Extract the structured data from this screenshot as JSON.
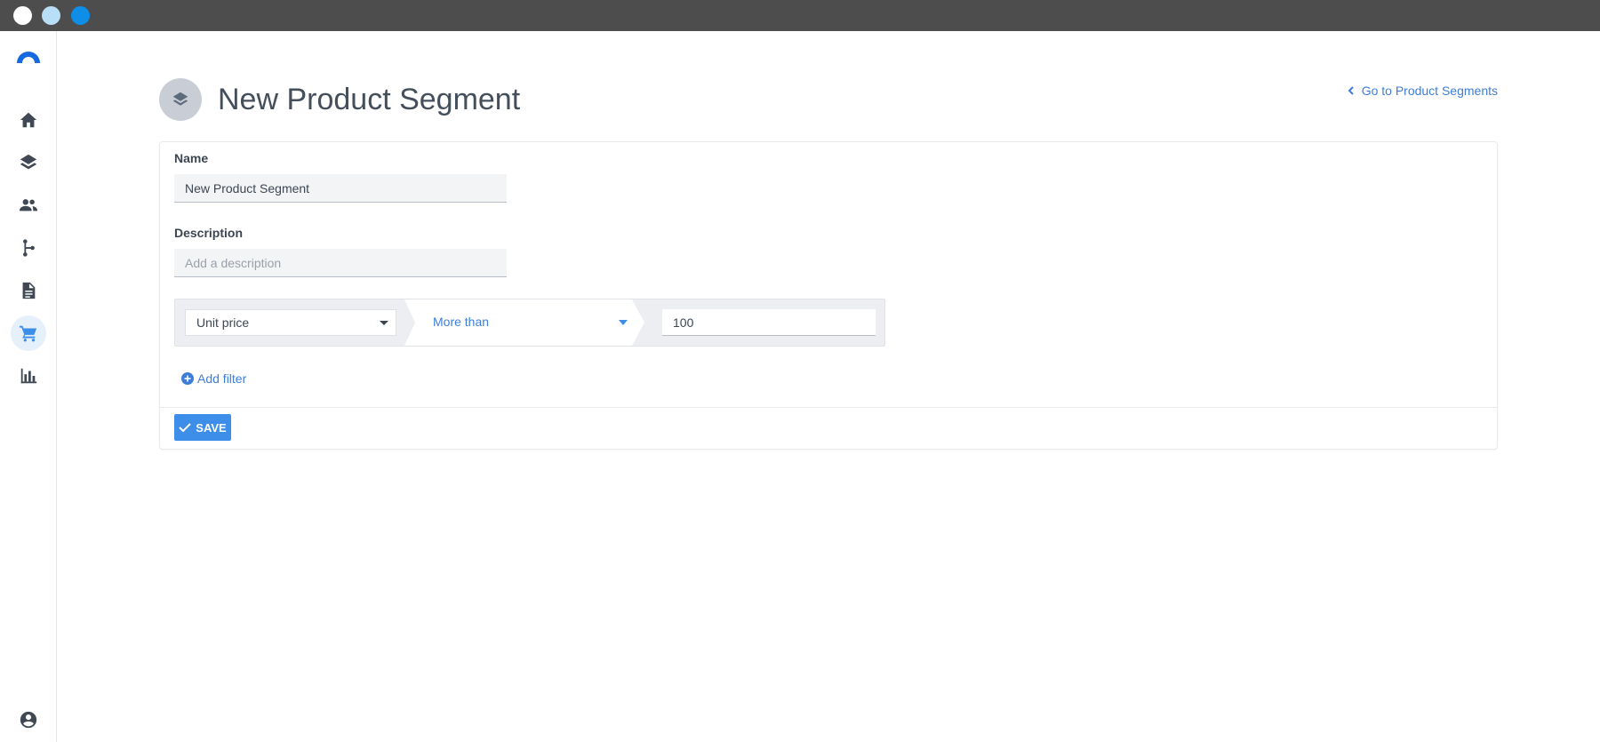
{
  "window": {
    "controls": [
      "close",
      "minimize",
      "maximize"
    ]
  },
  "sidebar": {
    "logo": "brand-logo",
    "items": [
      {
        "icon": "home-icon"
      },
      {
        "icon": "layers-icon"
      },
      {
        "icon": "people-icon"
      },
      {
        "icon": "branch-icon"
      },
      {
        "icon": "document-icon"
      },
      {
        "icon": "cart-icon",
        "active": true
      },
      {
        "icon": "bar-chart-icon"
      }
    ],
    "footer_icon": "account-circle-icon"
  },
  "header": {
    "icon": "layers-icon",
    "title": "New Product Segment",
    "back_link": "Go to Product Segments"
  },
  "form": {
    "name_label": "Name",
    "name_value": "New Product Segment",
    "description_label": "Description",
    "description_value": "",
    "description_placeholder": "Add a description",
    "filter": {
      "field": "Unit price",
      "operator": "More than",
      "value": "100"
    },
    "add_filter_label": "Add filter",
    "save_label": "SAVE"
  },
  "colors": {
    "accent": "#3d8ee8",
    "link": "#3d7ed8",
    "titlebar": "#4d4d4d"
  }
}
